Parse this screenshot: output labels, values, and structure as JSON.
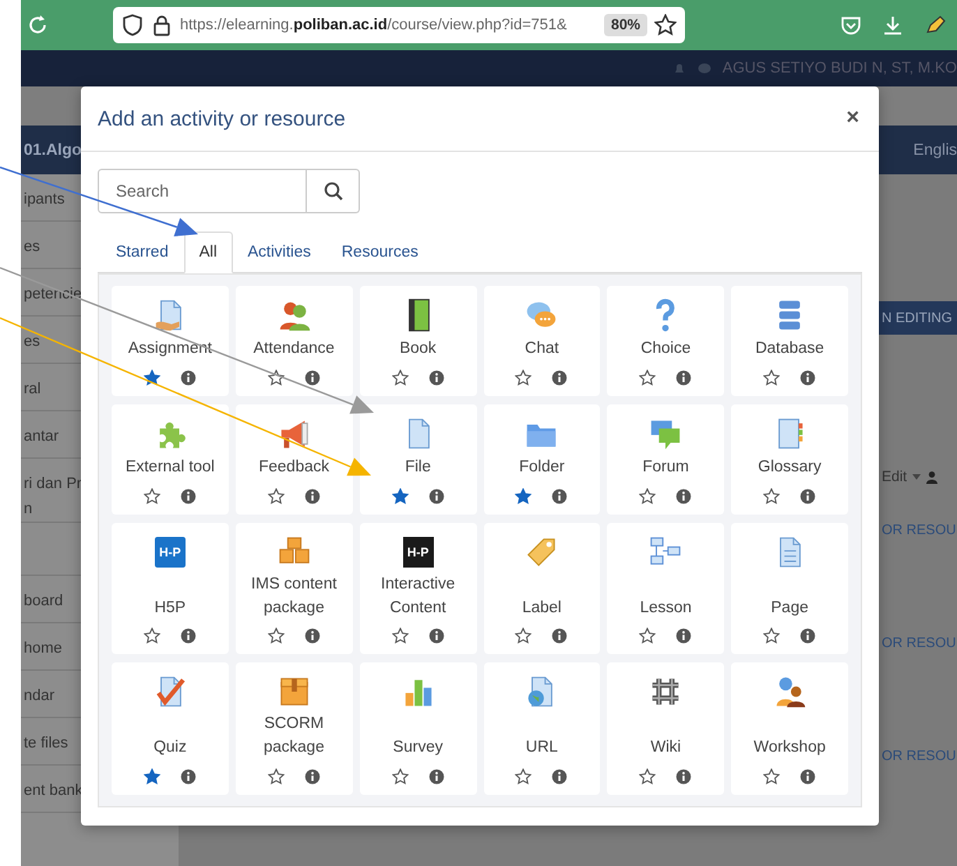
{
  "browser": {
    "url": "https://elearning.**poliban.ac.id**/course/view.php?id=751&",
    "zoom": "80%"
  },
  "header": {
    "user": "AGUS SETIYO BUDI N, ST, M.KO"
  },
  "course_bar": {
    "title": "01.Algo",
    "language": "Englis"
  },
  "sidebar": {
    "groups": [
      [
        "ipants",
        "es",
        "petencie",
        "es",
        "ral",
        "antar",
        "ri dan Pr\nn"
      ],
      [
        "board",
        "home",
        "ndar",
        "te files",
        "ent bank"
      ]
    ]
  },
  "right_panel": {
    "edit_button": "N EDITING",
    "edit_menu": "Edit",
    "add_links": [
      "OR RESOU",
      "OR RESOU",
      "OR RESOU"
    ]
  },
  "modal": {
    "title": "Add an activity or resource",
    "close": "×",
    "search": {
      "placeholder": "Search"
    },
    "tabs": [
      {
        "label": "Starred",
        "selected": false
      },
      {
        "label": "All",
        "selected": true
      },
      {
        "label": "Activities",
        "selected": false
      },
      {
        "label": "Resources",
        "selected": false
      }
    ],
    "items": [
      {
        "name": "Assignment",
        "starred": true
      },
      {
        "name": "Attendance",
        "starred": false
      },
      {
        "name": "Book",
        "starred": false
      },
      {
        "name": "Chat",
        "starred": false
      },
      {
        "name": "Choice",
        "starred": false
      },
      {
        "name": "Database",
        "starred": false
      },
      {
        "name": "External tool",
        "starred": false
      },
      {
        "name": "Feedback",
        "starred": false
      },
      {
        "name": "File",
        "starred": true
      },
      {
        "name": "Folder",
        "starred": true
      },
      {
        "name": "Forum",
        "starred": false
      },
      {
        "name": "Glossary",
        "starred": false
      },
      {
        "name": "H5P",
        "starred": false,
        "logo": "H-P"
      },
      {
        "name": "IMS content package",
        "starred": false
      },
      {
        "name": "Interactive Content",
        "starred": false,
        "logo": "H-P"
      },
      {
        "name": "Label",
        "starred": false
      },
      {
        "name": "Lesson",
        "starred": false
      },
      {
        "name": "Page",
        "starred": false
      },
      {
        "name": "Quiz",
        "starred": true
      },
      {
        "name": "SCORM package",
        "starred": false
      },
      {
        "name": "Survey",
        "starred": false
      },
      {
        "name": "URL",
        "starred": false
      },
      {
        "name": "Wiki",
        "starred": false
      },
      {
        "name": "Workshop",
        "starred": false
      }
    ]
  }
}
